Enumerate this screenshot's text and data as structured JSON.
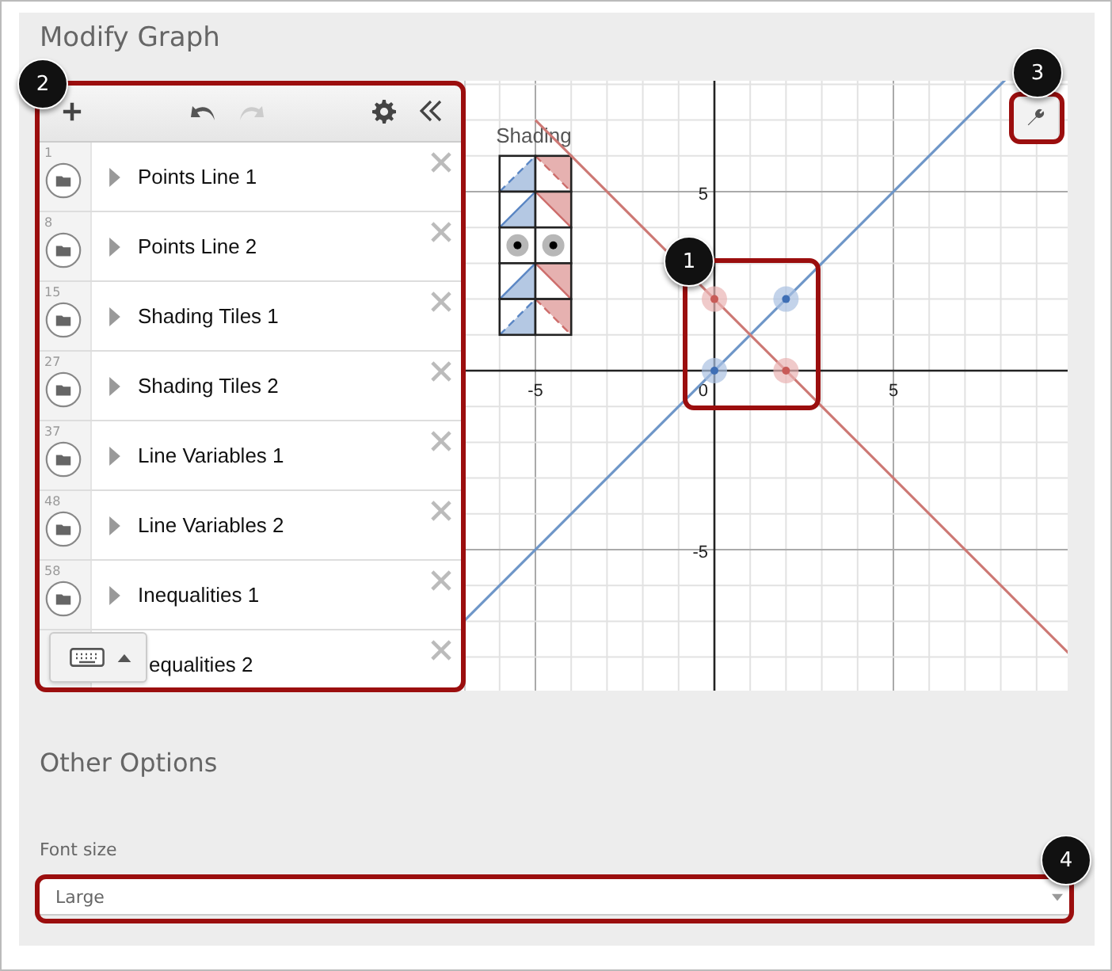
{
  "title": "Modify Graph",
  "expression_list": {
    "items": [
      {
        "number": "1",
        "label": "Points Line 1"
      },
      {
        "number": "8",
        "label": "Points Line 2"
      },
      {
        "number": "15",
        "label": "Shading Tiles 1"
      },
      {
        "number": "27",
        "label": "Shading Tiles 2"
      },
      {
        "number": "37",
        "label": "Line Variables 1"
      },
      {
        "number": "48",
        "label": "Line Variables 2"
      },
      {
        "number": "58",
        "label": "Inequalities 1"
      },
      {
        "label": "equalities 2"
      }
    ]
  },
  "graph": {
    "note": "Shading",
    "x_tick_labels": [
      "-5",
      "0",
      "5"
    ],
    "y_tick_labels": [
      "5",
      "-5"
    ]
  },
  "other_options": {
    "title": "Other Options",
    "font_size": {
      "label": "Font size",
      "value": "Large"
    }
  },
  "callouts": [
    "1",
    "2",
    "3",
    "4"
  ]
}
